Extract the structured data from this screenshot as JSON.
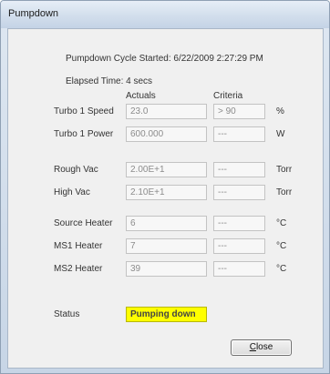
{
  "window": {
    "title": "Pumpdown"
  },
  "info": {
    "cycle_started": "Pumpdown Cycle Started: 6/22/2009 2:27:29 PM",
    "elapsed": "Elapsed Time: 4 secs"
  },
  "columns": {
    "actuals": "Actuals",
    "criteria": "Criteria"
  },
  "rows": [
    {
      "label": "Turbo 1 Speed",
      "actual": "23.0",
      "criteria": "> 90",
      "unit": "%"
    },
    {
      "label": "Turbo 1 Power",
      "actual": "600.000",
      "criteria": "---",
      "unit": "W"
    },
    {
      "label": "Rough Vac",
      "actual": "2.00E+1",
      "criteria": "---",
      "unit": "Torr"
    },
    {
      "label": "High Vac",
      "actual": "2.10E+1",
      "criteria": "---",
      "unit": "Torr"
    },
    {
      "label": "Source Heater",
      "actual": "6",
      "criteria": "---",
      "unit": "°C"
    },
    {
      "label": "MS1 Heater",
      "actual": "7",
      "criteria": "---",
      "unit": "°C"
    },
    {
      "label": "MS2 Heater",
      "actual": "39",
      "criteria": "---",
      "unit": "°C"
    }
  ],
  "status": {
    "label": "Status",
    "value": "Pumping down",
    "color": "#ffff00"
  },
  "buttons": {
    "close_mnemonic": "C",
    "close_rest": "lose"
  }
}
